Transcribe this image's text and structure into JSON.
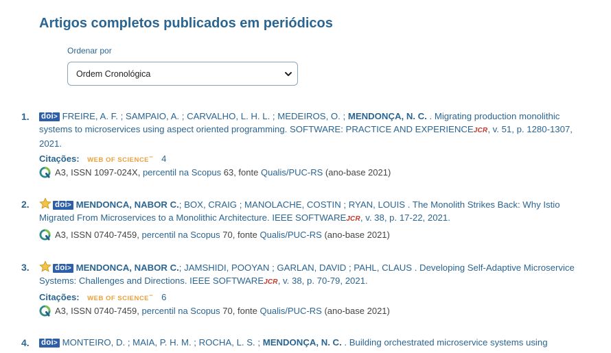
{
  "section_title": "Artigos completos publicados em periódicos",
  "order": {
    "label": "Ordenar por",
    "selected": "Ordem Cronológica"
  },
  "entries": [
    {
      "number": "1.",
      "doi": "doi",
      "authors_before": "FREIRE, A. F. ; SAMPAIO, A. ; CARVALHO, L. H. L. ; MEDEIROS, O. ;",
      "author_bold": "MENDONÇA, N. C.",
      "text_after": ". Migrating production monolithic systems to microservices using aspect oriented programming. SOFTWARE: PRACTICE AND EXPERIENCE",
      "jcr": "JCR",
      "tail": ", v. 51, p. 1280-1307, 2021.",
      "citations_label": "Citações:",
      "wos": "WEB OF SCIENCE",
      "citations_count": "4",
      "qualis": "A3, ISSN 1097-024X,",
      "scopus_link": "percentil na Scopus",
      "scopus_value": "63, fonte",
      "qualis_link": "Qualis/PUC-RS",
      "year_base": "(ano-base 2021)"
    },
    {
      "number": "2.",
      "doi": "doi",
      "author_bold": "MENDONCA, NABOR C.",
      "text_after": "; BOX, CRAIG ; MANOLACHE, COSTIN ; RYAN, LOUIS . The Monolith Strikes Back: Why Istio Migrated From Microservices to a Monolithic Architecture. IEEE SOFTWARE",
      "jcr": "JCR",
      "tail": ", v. 38, p. 17-22, 2021.",
      "qualis": "A3, ISSN 0740-7459,",
      "scopus_link": "percentil na Scopus",
      "scopus_value": "70, fonte",
      "qualis_link": "Qualis/PUC-RS",
      "year_base": "(ano-base 2021)"
    },
    {
      "number": "3.",
      "doi": "doi",
      "author_bold": "MENDONCA, NABOR C.",
      "text_after": "; JAMSHIDI, POOYAN ; GARLAN, DAVID ; PAHL, CLAUS . Developing Self-Adaptive Microservice Systems: Challenges and Directions. IEEE SOFTWARE",
      "jcr": "JCR",
      "tail": ", v. 38, p. 70-79, 2021.",
      "citations_label": "Citações:",
      "wos": "WEB OF SCIENCE",
      "citations_count": "6",
      "qualis": "A3, ISSN 0740-7459,",
      "scopus_link": "percentil na Scopus",
      "scopus_value": "70, fonte",
      "qualis_link": "Qualis/PUC-RS",
      "year_base": "(ano-base 2021)"
    },
    {
      "number": "4.",
      "doi": "doi",
      "authors_before": "MONTEIRO, D. ; MAIA, P. H. M. ; ROCHA, L. S. ;",
      "author_bold": "MENDONÇA, N. C.",
      "text_after": ". Building orchestrated microservice systems using"
    }
  ]
}
